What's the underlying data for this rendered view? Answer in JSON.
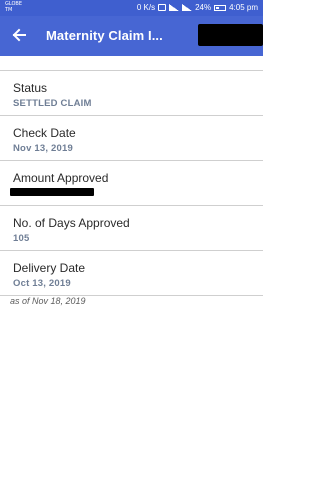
{
  "status_bar": {
    "carrier": "GLOBE\nTM",
    "speed": "0 K/s",
    "battery": "24%",
    "time": "4:05 pm"
  },
  "app_bar": {
    "title": "Maternity Claim I..."
  },
  "details": [
    {
      "label": "Status",
      "value": "SETTLED CLAIM"
    },
    {
      "label": "Check Date",
      "value": "Nov 13, 2019"
    },
    {
      "label": "Amount Approved",
      "value": ""
    },
    {
      "label": "No. of Days Approved",
      "value": "105"
    },
    {
      "label": "Delivery Date",
      "value": "Oct 13, 2019"
    }
  ],
  "footnote": "as of Nov 18, 2019"
}
